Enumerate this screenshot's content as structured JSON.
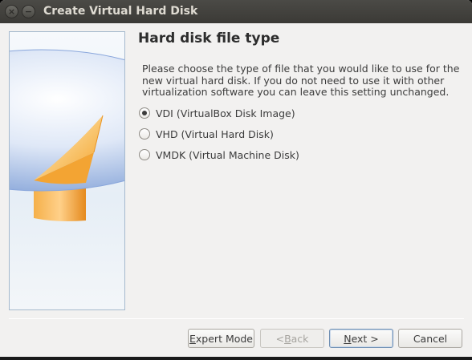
{
  "window": {
    "title": "Create Virtual Hard Disk",
    "close_icon": "close-icon",
    "minimize_icon": "minimize-icon"
  },
  "side_image": "virtual-disk-illustration",
  "page": {
    "heading": "Hard disk file type",
    "description": "Please choose the type of file that you would like to use for the new virtual hard disk. If you do not need to use it with other virtualization software you can leave this setting unchanged."
  },
  "options": [
    {
      "label": "VDI (VirtualBox Disk Image)",
      "checked": true
    },
    {
      "label": "VHD (Virtual Hard Disk)",
      "checked": false
    },
    {
      "label": "VMDK (Virtual Machine Disk)",
      "checked": false
    }
  ],
  "buttons": {
    "expert_mode": {
      "pre": "",
      "mnemonic": "E",
      "post": "xpert Mode"
    },
    "back": {
      "pre": "< ",
      "mnemonic": "B",
      "post": "ack",
      "disabled": true
    },
    "next": {
      "pre": "",
      "mnemonic": "N",
      "post": "ext >"
    },
    "cancel": {
      "label": "Cancel"
    }
  },
  "colors": {
    "titlebar": "#3c3b37",
    "window_bg": "#f2f1f0",
    "disk_orange": "#f5a02a",
    "disk_blue": "#3f6fc8"
  }
}
